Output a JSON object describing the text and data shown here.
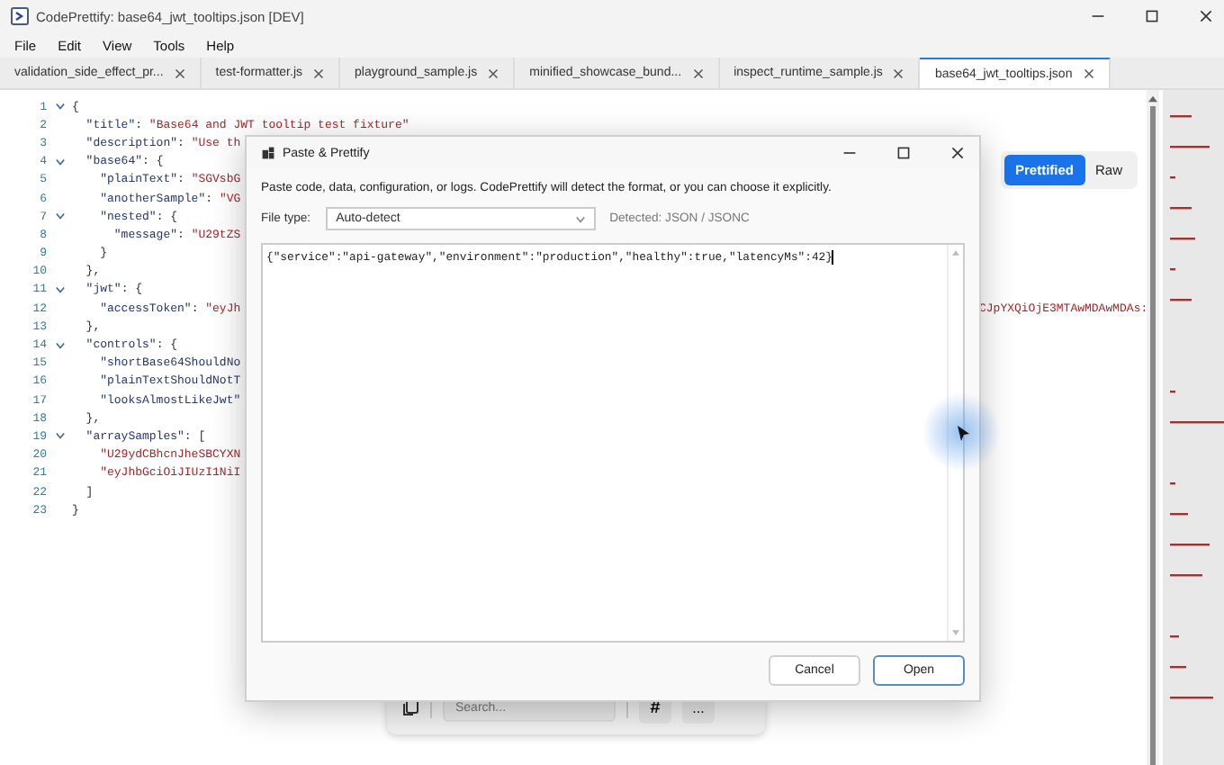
{
  "window": {
    "title": "CodePrettify: base64_jwt_tooltips.json [DEV]"
  },
  "menu": [
    "File",
    "Edit",
    "View",
    "Tools",
    "Help"
  ],
  "tabs": [
    {
      "label": "validation_side_effect_pr...",
      "selected": false
    },
    {
      "label": "test-formatter.js",
      "selected": false
    },
    {
      "label": "playground_sample.js",
      "selected": false
    },
    {
      "label": "minified_showcase_bund...",
      "selected": false
    },
    {
      "label": "inspect_runtime_sample.js",
      "selected": false
    },
    {
      "label": "base64_jwt_tooltips.json",
      "selected": true
    }
  ],
  "view_toggle": [
    {
      "label": "Prettified",
      "selected": true
    },
    {
      "label": "Raw",
      "selected": false
    }
  ],
  "editor": {
    "lines": [
      {
        "number": "1",
        "foldable": true,
        "tokens": [
          {
            "kind": "punct",
            "text": "{"
          }
        ]
      },
      {
        "number": "2",
        "foldable": false,
        "tokens": [
          {
            "kind": "key",
            "text": "  \"title\""
          },
          {
            "kind": "punct",
            "text": ": "
          },
          {
            "kind": "str",
            "text": "\"Base64 and JWT tooltip test fixture\""
          }
        ]
      },
      {
        "number": "3",
        "foldable": false,
        "tokens": [
          {
            "kind": "key",
            "text": "  \"description\""
          },
          {
            "kind": "punct",
            "text": ": "
          },
          {
            "kind": "str",
            "text": "\"Use th"
          }
        ]
      },
      {
        "number": "4",
        "foldable": true,
        "tokens": [
          {
            "kind": "key",
            "text": "  \"base64\""
          },
          {
            "kind": "punct",
            "text": ": {"
          }
        ]
      },
      {
        "number": "5",
        "foldable": false,
        "tokens": [
          {
            "kind": "key",
            "text": "    \"plainText\""
          },
          {
            "kind": "punct",
            "text": ": "
          },
          {
            "kind": "str",
            "text": "\"SGVsbG"
          }
        ]
      },
      {
        "number": "6",
        "foldable": false,
        "tokens": [
          {
            "kind": "key",
            "text": "    \"anotherSample\""
          },
          {
            "kind": "punct",
            "text": ": "
          },
          {
            "kind": "str",
            "text": "\"VG"
          }
        ]
      },
      {
        "number": "7",
        "foldable": true,
        "tokens": [
          {
            "kind": "key",
            "text": "    \"nested\""
          },
          {
            "kind": "punct",
            "text": ": {"
          }
        ]
      },
      {
        "number": "8",
        "foldable": false,
        "tokens": [
          {
            "kind": "key",
            "text": "      \"message\""
          },
          {
            "kind": "punct",
            "text": ": "
          },
          {
            "kind": "str",
            "text": "\"U29tZS"
          }
        ]
      },
      {
        "number": "9",
        "foldable": false,
        "tokens": [
          {
            "kind": "punct",
            "text": "    }"
          }
        ]
      },
      {
        "number": "10",
        "foldable": false,
        "tokens": [
          {
            "kind": "punct",
            "text": "  },"
          }
        ]
      },
      {
        "number": "11",
        "foldable": true,
        "tokens": [
          {
            "kind": "key",
            "text": "  \"jwt\""
          },
          {
            "kind": "punct",
            "text": ": {"
          }
        ]
      },
      {
        "number": "12",
        "foldable": false,
        "tokens": [
          {
            "kind": "key",
            "text": "    \"accessToken\""
          },
          {
            "kind": "punct",
            "text": ": "
          },
          {
            "kind": "str",
            "text": "\"eyJh"
          }
        ],
        "tail": "CJpYXQiOjE3MTAwMDAwMDAs:"
      },
      {
        "number": "13",
        "foldable": false,
        "tokens": [
          {
            "kind": "punct",
            "text": "  },"
          }
        ]
      },
      {
        "number": "14",
        "foldable": true,
        "tokens": [
          {
            "kind": "key",
            "text": "  \"controls\""
          },
          {
            "kind": "punct",
            "text": ": {"
          }
        ]
      },
      {
        "number": "15",
        "foldable": false,
        "tokens": [
          {
            "kind": "key",
            "text": "    \"shortBase64ShouldNo"
          }
        ]
      },
      {
        "number": "16",
        "foldable": false,
        "tokens": [
          {
            "kind": "key",
            "text": "    \"plainTextShouldNotT"
          }
        ]
      },
      {
        "number": "17",
        "foldable": false,
        "tokens": [
          {
            "kind": "key",
            "text": "    \"looksAlmostLikeJwt\""
          }
        ]
      },
      {
        "number": "18",
        "foldable": false,
        "tokens": [
          {
            "kind": "punct",
            "text": "  },"
          }
        ]
      },
      {
        "number": "19",
        "foldable": true,
        "tokens": [
          {
            "kind": "key",
            "text": "  \"arraySamples\""
          },
          {
            "kind": "punct",
            "text": ": ["
          }
        ]
      },
      {
        "number": "20",
        "foldable": false,
        "tokens": [
          {
            "kind": "str",
            "text": "    \"U29ydCBhcnJheSBCYXN"
          }
        ]
      },
      {
        "number": "21",
        "foldable": false,
        "tokens": [
          {
            "kind": "str",
            "text": "    \"eyJhbGciOiJIUzI1NiI"
          }
        ]
      },
      {
        "number": "22",
        "foldable": false,
        "tokens": [
          {
            "kind": "punct",
            "text": "  ]"
          }
        ]
      },
      {
        "number": "23",
        "foldable": false,
        "tokens": [
          {
            "kind": "punct",
            "text": "}"
          }
        ]
      }
    ]
  },
  "dialog": {
    "title": "Paste & Prettify",
    "description": "Paste code, data, configuration, or logs. CodePrettify will detect the format, or you can choose it explicitly.",
    "file_type_label": "File type:",
    "file_type": "Auto-detect",
    "detected": "Detected: JSON / JSONC",
    "content": "{\"service\":\"api-gateway\",\"environment\":\"production\",\"healthy\":true,\"latencyMs\":42}",
    "buttons": [
      {
        "label": "Cancel",
        "default": false
      },
      {
        "label": "Open",
        "default": true
      }
    ]
  },
  "toolbar": {
    "search_placeholder": "Search...",
    "hash_button": "#",
    "more_button": "..."
  }
}
